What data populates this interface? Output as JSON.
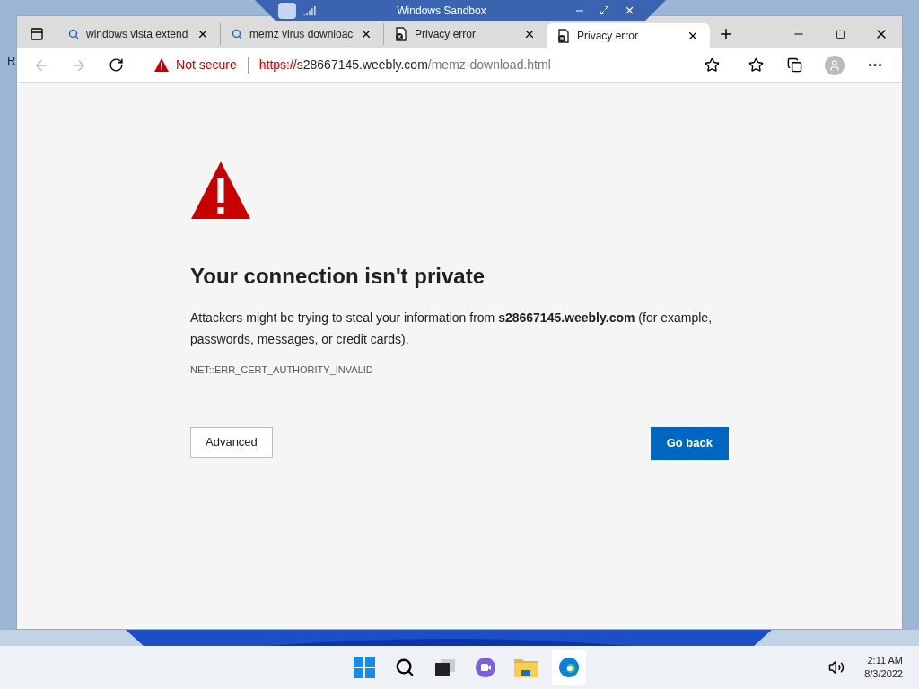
{
  "sandbox_bar": {
    "title": "Windows Sandbox"
  },
  "desktop_fragment": "R",
  "tabs": [
    {
      "label": "windows vista extend",
      "kind": "search",
      "selected": false
    },
    {
      "label": "memz virus downloac",
      "kind": "search",
      "selected": false
    },
    {
      "label": "Privacy error",
      "kind": "error",
      "selected": false
    },
    {
      "label": "Privacy error",
      "kind": "error",
      "selected": true
    }
  ],
  "address_bar": {
    "security": "Not secure",
    "scheme": "https://",
    "host": "s28667145.weebly.com",
    "path": "/memz-download.html"
  },
  "page": {
    "heading": "Your connection isn't private",
    "message": "Attackers might be trying to steal your information from **s28667145.weebly.com** (for example, passwords, messages, or credit cards).",
    "error_code": "NET::ERR_CERT_AUTHORITY_INVALID",
    "advanced_button": "Advanced",
    "back_button": "Go back"
  },
  "taskbar": {
    "time": "2:11 AM",
    "date": "8/3/2022"
  }
}
